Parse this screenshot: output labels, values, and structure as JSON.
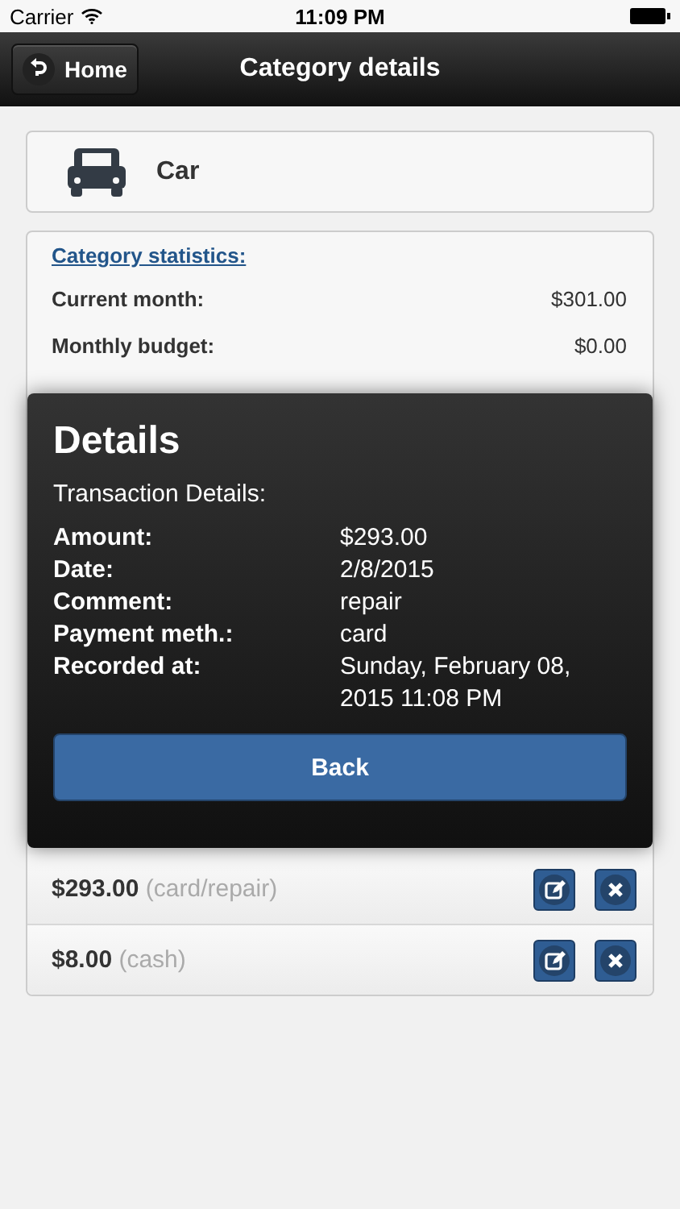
{
  "status_bar": {
    "carrier": "Carrier",
    "time": "11:09 PM"
  },
  "header": {
    "back_button": "Home",
    "title": "Category details"
  },
  "category": {
    "name": "Car"
  },
  "statistics": {
    "heading": "Category statistics:",
    "rows": [
      {
        "label": "Current month:",
        "value": "$301.00"
      },
      {
        "label": "Monthly budget:",
        "value": "$0.00"
      }
    ]
  },
  "transactions": [
    {
      "amount": "$293.00",
      "note": "(card/repair)"
    },
    {
      "amount": "$8.00",
      "note": "(cash)"
    }
  ],
  "dialog": {
    "title": "Details",
    "subtitle": "Transaction Details:",
    "fields": [
      {
        "label": "Amount:",
        "value": "$293.00"
      },
      {
        "label": "Date:",
        "value": "2/8/2015"
      },
      {
        "label": "Comment:",
        "value": "repair"
      },
      {
        "label": "Payment meth.:",
        "value": "card"
      },
      {
        "label": "Recorded at:",
        "value": "Sunday, February 08, 2015 11:08 PM"
      }
    ],
    "button": "Back"
  }
}
